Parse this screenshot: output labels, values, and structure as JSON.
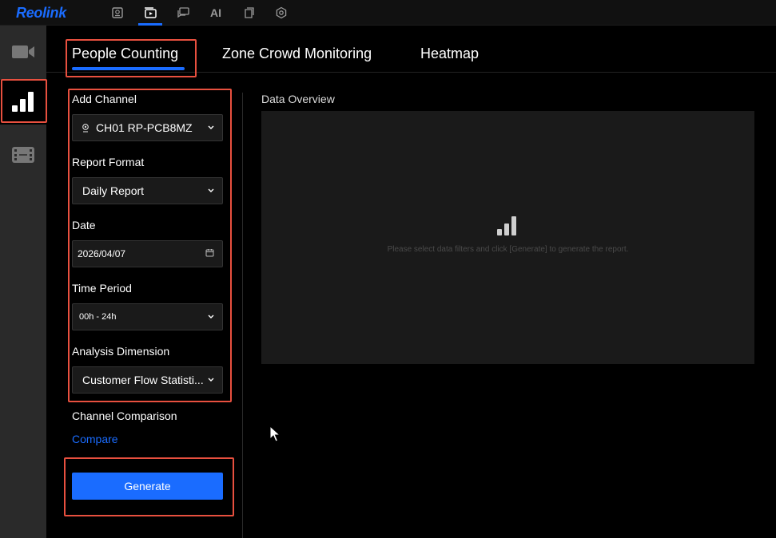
{
  "app": {
    "logo": "Reolink"
  },
  "topnav": {
    "items": [
      {
        "name": "live-view",
        "icon": "camera-box-icon"
      },
      {
        "name": "playback",
        "icon": "play-box-icon",
        "active": true
      },
      {
        "name": "messages",
        "icon": "chat-icon"
      },
      {
        "name": "ai",
        "label": "AI"
      },
      {
        "name": "files",
        "icon": "document-icon"
      },
      {
        "name": "settings",
        "icon": "gear-icon"
      }
    ]
  },
  "sidebar": {
    "items": [
      {
        "name": "video",
        "icon": "video-camera-icon"
      },
      {
        "name": "statistics",
        "icon": "bar-chart-icon",
        "active": true
      },
      {
        "name": "film",
        "icon": "film-icon"
      }
    ]
  },
  "tabs": [
    {
      "label": "People Counting",
      "active": true
    },
    {
      "label": "Zone Crowd Monitoring"
    },
    {
      "label": "Heatmap"
    }
  ],
  "filters": {
    "channel": {
      "label": "Add Channel",
      "value": "CH01 RP-PCB8MZ"
    },
    "report_format": {
      "label": "Report Format",
      "value": "Daily Report"
    },
    "date": {
      "label": "Date",
      "value": "2026/04/07"
    },
    "time_period": {
      "label": "Time Period",
      "value": "00h - 24h"
    },
    "analysis_dimension": {
      "label": "Analysis Dimension",
      "value": "Customer Flow Statisti..."
    },
    "channel_comparison": {
      "label": "Channel Comparison",
      "link": "Compare"
    },
    "generate_label": "Generate"
  },
  "overview": {
    "title": "Data Overview",
    "empty_message": "Please select data filters and click [Generate] to generate the report."
  },
  "colors": {
    "accent": "#1a6cff",
    "highlight": "#e8503f",
    "sidebar": "#2a2a2a"
  }
}
